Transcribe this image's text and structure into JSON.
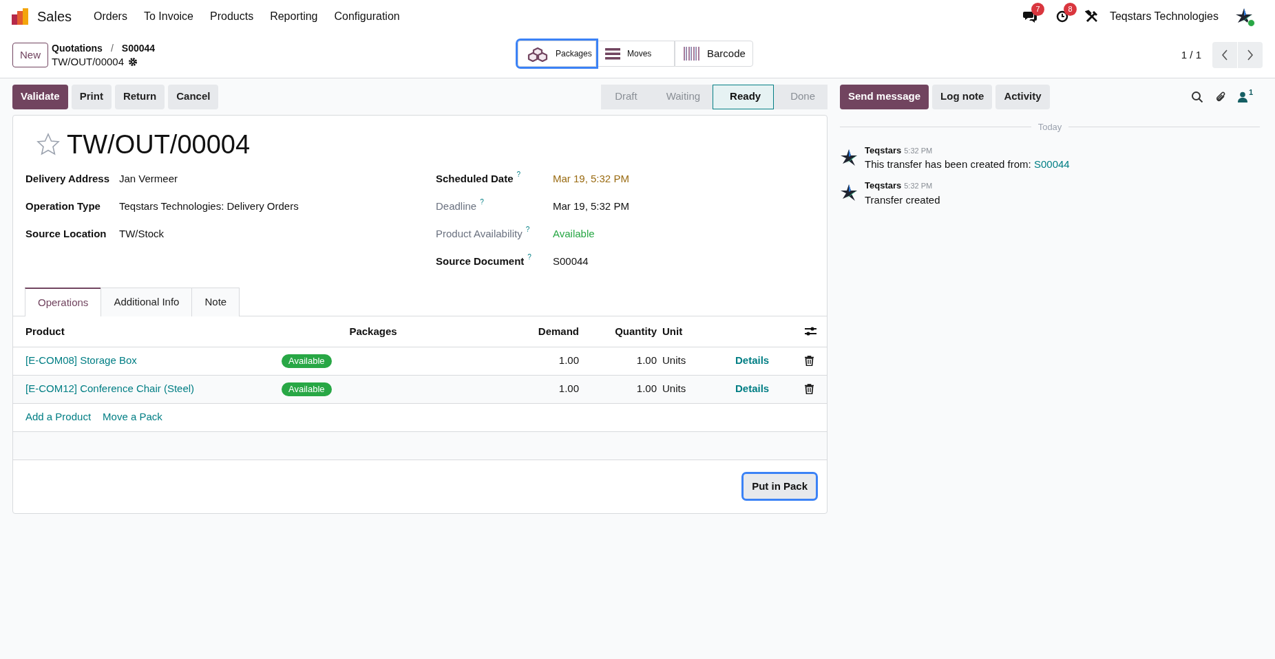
{
  "navbar": {
    "app": "Sales",
    "menu": [
      "Orders",
      "To Invoice",
      "Products",
      "Reporting",
      "Configuration"
    ],
    "messages_badge": "7",
    "activities_badge": "8",
    "company": "Teqstars Technologies"
  },
  "control_panel": {
    "new_button": "New",
    "breadcrumbs": [
      "Quotations",
      "S00044"
    ],
    "breadcrumb_separator": "/",
    "current": "TW/OUT/00004",
    "smart_buttons": [
      {
        "kind": "packages",
        "label": "Packages",
        "highlighted": true
      },
      {
        "kind": "moves",
        "label": "Moves",
        "highlighted": false
      },
      {
        "kind": "barcode",
        "label": "Barcode",
        "highlighted": false
      }
    ],
    "pager": "1 / 1"
  },
  "actions": [
    {
      "label": "Validate",
      "primary": true
    },
    {
      "label": "Print",
      "primary": false
    },
    {
      "label": "Return",
      "primary": false
    },
    {
      "label": "Cancel",
      "primary": false
    }
  ],
  "stages": [
    {
      "label": "Draft",
      "selected": false
    },
    {
      "label": "Waiting",
      "selected": false
    },
    {
      "label": "Ready",
      "selected": true
    },
    {
      "label": "Done",
      "selected": false
    }
  ],
  "form": {
    "favorite": false,
    "title": "TW/OUT/00004",
    "left_fields": [
      {
        "label": "Delivery Address",
        "value": "Jan Vermeer",
        "readonly": false,
        "color": "#111111"
      },
      {
        "label": "Operation Type",
        "value": "Teqstars Technologies: Delivery Orders",
        "readonly": false,
        "color": "#111111"
      },
      {
        "label": "Source Location",
        "value": "TW/Stock",
        "readonly": false,
        "color": "#111111"
      }
    ],
    "right_fields": [
      {
        "label": "Scheduled Date",
        "help": "?",
        "value": "Mar 19, 5:32 PM",
        "readonly": false,
        "color": "#9a6b12"
      },
      {
        "label": "Deadline",
        "help": "?",
        "value": "Mar 19, 5:32 PM",
        "readonly": true,
        "color": "#111111"
      },
      {
        "label": "Product Availability",
        "help": "?",
        "value": "Available",
        "readonly": true,
        "color": "#28a745"
      },
      {
        "label": "Source Document",
        "help": "?",
        "value": "S00044",
        "readonly": false,
        "color": "#111111"
      }
    ],
    "tabs": [
      {
        "label": "Operations",
        "selected": true
      },
      {
        "label": "Additional Info",
        "selected": false
      },
      {
        "label": "Note",
        "selected": false
      }
    ],
    "table": {
      "columns": [
        "Product",
        "Packages",
        "Demand",
        "Quantity",
        "Unit"
      ],
      "rows": [
        {
          "product": "[E-COM08] Storage Box",
          "status": "Available",
          "demand": "1.00",
          "quantity": "1.00",
          "unit": "Units",
          "details": "Details"
        },
        {
          "product": "[E-COM12] Conference Chair (Steel)",
          "status": "Available",
          "demand": "1.00",
          "quantity": "1.00",
          "unit": "Units",
          "details": "Details"
        }
      ],
      "links": [
        "Add a Product",
        "Move a Pack"
      ]
    },
    "put_in_pack": {
      "label": "Put in Pack",
      "highlighted": true
    }
  },
  "chatter": {
    "buttons": [
      {
        "label": "Send message",
        "primary": true
      },
      {
        "label": "Log note",
        "primary": false
      },
      {
        "label": "Activity",
        "primary": false
      }
    ],
    "followers_count": "1",
    "separator": "Today",
    "messages": [
      {
        "author": "Teqstars",
        "time": "5:32 PM",
        "text": "This transfer has been created from:",
        "link": "S00044"
      },
      {
        "author": "Teqstars",
        "time": "5:32 PM",
        "text": "Transfer created"
      }
    ]
  }
}
